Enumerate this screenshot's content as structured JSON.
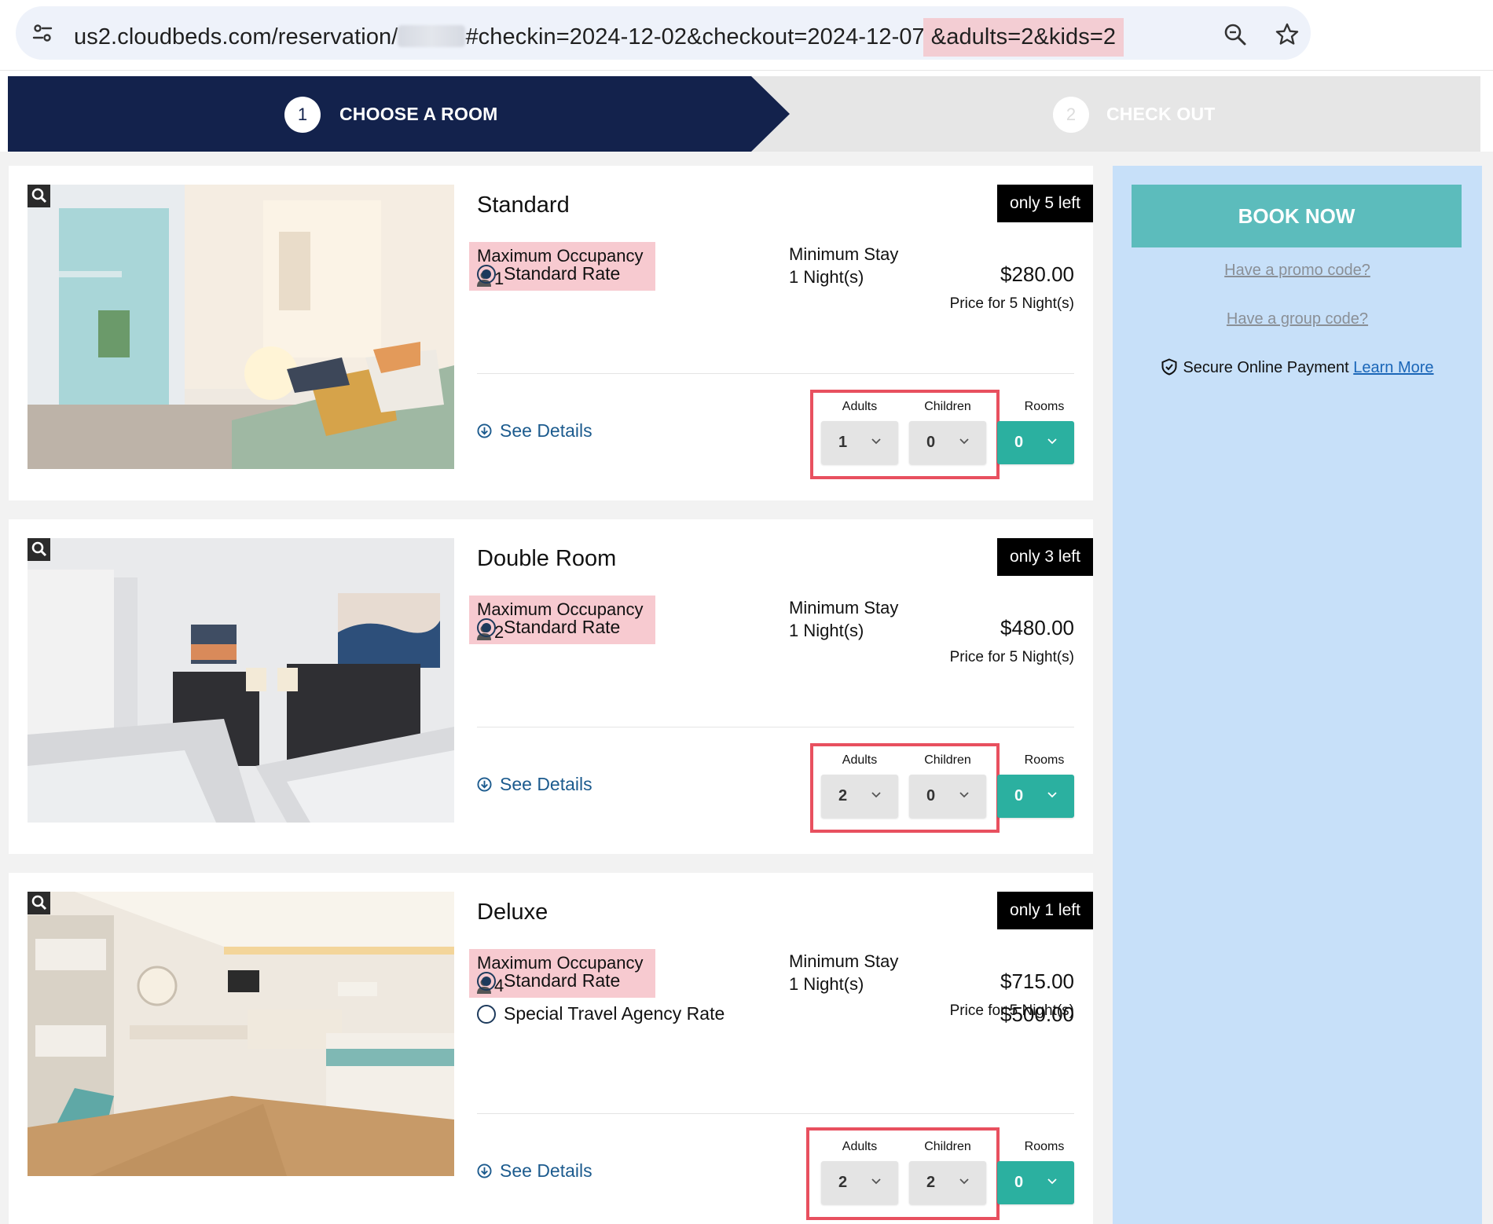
{
  "browser": {
    "url_prefix": "us2.cloudbeds.com/reservation/",
    "url_query": "#checkin=2024-12-02&checkout=2024-12-07",
    "url_highlight": "&adults=2&kids=2"
  },
  "steps": [
    {
      "number": "1",
      "label": "CHOOSE A ROOM"
    },
    {
      "number": "2",
      "label": "CHECK OUT"
    }
  ],
  "labels": {
    "max_occupancy": "Maximum Occupancy",
    "min_stay": "Minimum Stay",
    "see_details": "See Details",
    "adults": "Adults",
    "children": "Children",
    "rooms": "Rooms"
  },
  "rooms": [
    {
      "title": "Standard",
      "availability": "only 5 left",
      "occupancy": "1",
      "min_stay": "1 Night(s)",
      "price_label": "Price for 5 Night(s)",
      "rates": [
        {
          "name": "Standard Rate",
          "price": "$280.00",
          "selected": true
        }
      ],
      "adults": "1",
      "children": "0",
      "rooms": "0"
    },
    {
      "title": "Double Room",
      "availability": "only 3 left",
      "occupancy": "2",
      "min_stay": "1 Night(s)",
      "price_label": "Price for 5 Night(s)",
      "rates": [
        {
          "name": "Standard Rate",
          "price": "$480.00",
          "selected": true
        }
      ],
      "adults": "2",
      "children": "0",
      "rooms": "0"
    },
    {
      "title": "Deluxe",
      "availability": "only 1 left",
      "occupancy": "4",
      "min_stay": "1 Night(s)",
      "price_label": "Price for 5 Night(s)",
      "rates": [
        {
          "name": "Standard Rate",
          "price": "$715.00",
          "selected": true
        },
        {
          "name": "Special Travel Agency Rate",
          "price": "$500.00",
          "selected": false
        }
      ],
      "adults": "2",
      "children": "2",
      "rooms": "0"
    }
  ],
  "sidebar": {
    "book_now": "BOOK NOW",
    "promo": "Have a promo code?",
    "group": "Have a group code?",
    "secure_text": "Secure Online Payment",
    "learn_more": "Learn More"
  },
  "colors": {
    "nav_dark": "#13224c",
    "book_now": "#5cbcbc",
    "rooms_select": "#2bb0a0",
    "sidebar_bg": "#c7e0f9",
    "highlight_pink": "#f7cad0",
    "annotation_red": "#e8505f"
  }
}
